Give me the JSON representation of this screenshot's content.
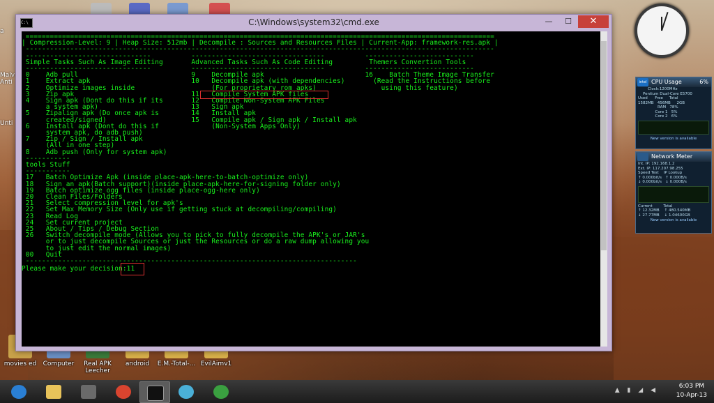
{
  "window": {
    "title": "C:\\Windows\\system32\\cmd.exe",
    "minimize": "—",
    "maximize": "☐",
    "close": "✕",
    "cmd_icon": "C:\\"
  },
  "console": {
    "lines": [
      " ====================================================================================================================",
      "| Compression-Level: 9 | Heap Size: 512mb | Decompile : Sources and Resources Files | Current-App: framework-res.apk |",
      " --------------------------------------------------------------------------------------------------------------------",
      " -------------------------------          ---------------------------------          ---------------------------",
      " Simple Tasks Such As Image Editing       Advanced Tasks Such As Code Editing         Themers Convertion Tools",
      " -------------------------------          ---------------------------------          ---------------------------",
      " 0    Adb pull                            9    Decompile apk                         16    Batch Theme Image Transfer",
      " 1    Extract apk                         10   Decompile apk (with dependencies)       (Read the Instructions before",
      " 2    Optimize images inside                   (For proprietary rom apks)                using this feature)",
      " 3    Zip apk                             11   Compile System APK files",
      " 4    Sign apk (Dont do this if its       12   Compile Non-System APK Files",
      "      a system apk)                       13   Sign apk",
      " 5    Zipalign apk (Do once apk is        14   Install apk",
      "      created/signed)                     15   Compile apk / Sign apk / Install apk",
      " 6    Install apk (Dont do this if             (Non-System Apps Only)",
      "      system apk, do adb push)",
      " 7    Zip / Sign / Install apk",
      "      (All in one step)",
      " 8    Adb push (Only for system apk)",
      " -----------",
      " tools Stuff",
      " -----------",
      " 17   Batch Optimize Apk (inside place-apk-here-to-batch-optimize only)",
      " 18   Sign an apk(Batch support)(inside place-apk-here-for-signing folder only)",
      " 19   Batch optimize ogg files (inside place-ogg-here only)",
      " 20   Clean Files/Folders",
      " 21   Select compression level for apk's",
      " 22   Set Max Memory Size (Only use if getting stuck at decompiling/compiling)",
      " 23   Read Log",
      " 24   Set current project",
      " 25   About / Tips / Debug Section",
      " 26   Switch decompile mode (Allows you to pick to fully decompile the APK's or JAR's",
      "      or to just decompile Sources or just the Resources or do a raw dump allowing you",
      "      to just edit the normal images)",
      " 00   Quit",
      " ----------------------------------------------------------------------------------",
      "Please make your decision:11"
    ]
  },
  "desktop": {
    "icons": [
      {
        "label": "movies ed",
        "color": "#c9a24a"
      },
      {
        "label": "Computer",
        "color": "#6a8fc4"
      },
      {
        "label": "Real APK Leecher",
        "color": "#3a7a3a"
      },
      {
        "label": "android",
        "color": "#d8b04a"
      },
      {
        "label": "E.M.-Total-...",
        "color": "#d8b04a"
      },
      {
        "label": "EvilAimv1",
        "color": "#d8b04a"
      }
    ],
    "left_truncated": [
      "a",
      "Malv",
      "Anti",
      "Unti"
    ]
  },
  "gadgets": {
    "cpu": {
      "title": "CPU Usage",
      "percent": "6%",
      "logo": "intel",
      "lines": [
        "        Clock:1200MHz",
        "    Pentium Dual-Core E5700",
        "Used      Free     Total",
        "1582MB   456MB     2GB",
        "                RAM   78%",
        "              Core 1   5%",
        "              Core 2   6%"
      ],
      "footer": "New version is available"
    },
    "network": {
      "title": "Network Meter",
      "lines": [
        "Int. IP: 192.168.1.2",
        "Ext. IP: 117.207.98.255",
        "Speed Test    IP Lookup",
        "↑ 0.000bit/s   ↑ 0.000B/s",
        "↓ 0.000bit/s   ↓ 0.000B/s"
      ],
      "stats": [
        "Current         Total",
        "↑ 12.32MB    ↑ 480.540MB",
        "↓ 27.77MB    ↓ 1.04600GB"
      ],
      "footer": "New version is available"
    }
  },
  "taskbar": {
    "time": "6:03 PM",
    "date": "10-Apr-13",
    "apps": [
      {
        "name": "internet-explorer",
        "color": "#2a7fd4"
      },
      {
        "name": "file-explorer",
        "color": "#e8c35a"
      },
      {
        "name": "game-app",
        "color": "#6a6a6a"
      },
      {
        "name": "chrome",
        "color": "#d9442f"
      },
      {
        "name": "command-prompt",
        "color": "#111111"
      },
      {
        "name": "paint-app",
        "color": "#4ab0d8"
      },
      {
        "name": "network-app",
        "color": "#3aa040"
      }
    ]
  },
  "colors": {
    "console_text": "#19f11d",
    "highlight_box": "#e03030",
    "titlebar": "#c7b6d7"
  }
}
